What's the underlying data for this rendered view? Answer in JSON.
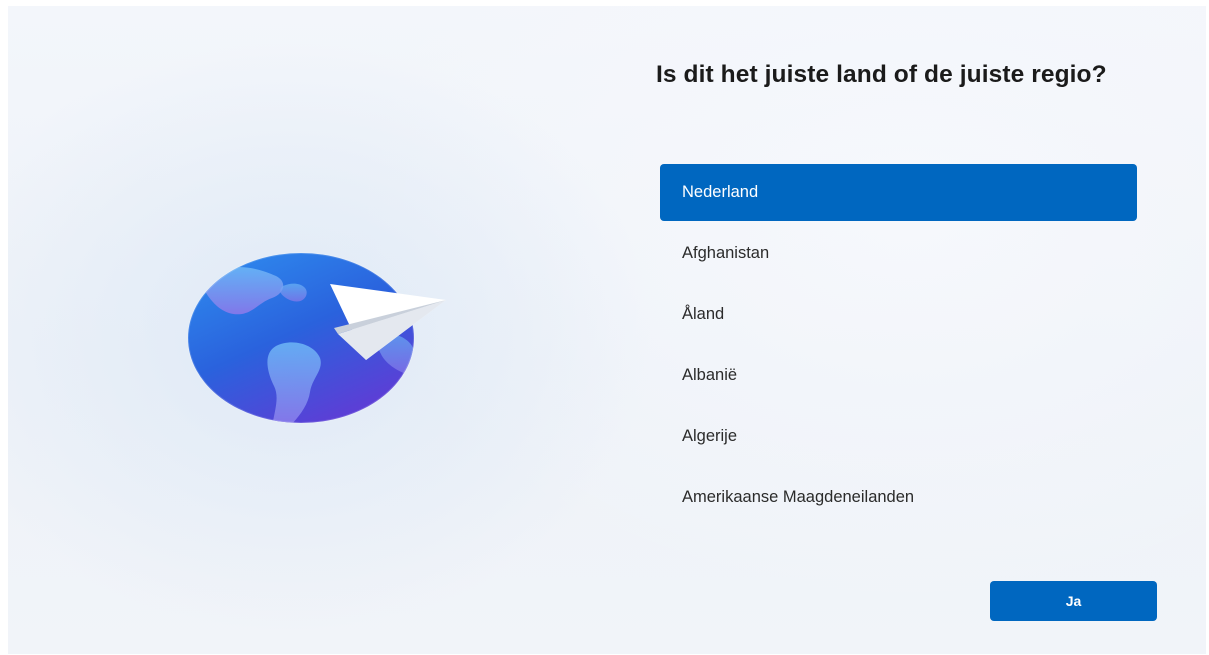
{
  "setup": {
    "question": "Is dit het juiste land of de juiste regio?",
    "illustration_icon": "globe-with-paper-plane-icon",
    "countries": [
      {
        "label": "Nederland",
        "selected": true
      },
      {
        "label": "Afghanistan",
        "selected": false
      },
      {
        "label": "Åland",
        "selected": false
      },
      {
        "label": "Albanië",
        "selected": false
      },
      {
        "label": "Algerije",
        "selected": false
      },
      {
        "label": "Amerikaanse Maagdeneilanden",
        "selected": false
      }
    ],
    "confirm_label": "Ja"
  },
  "colors": {
    "accent": "#0067c0",
    "background": "#f1f4f9",
    "text": "#1b1b1b"
  }
}
